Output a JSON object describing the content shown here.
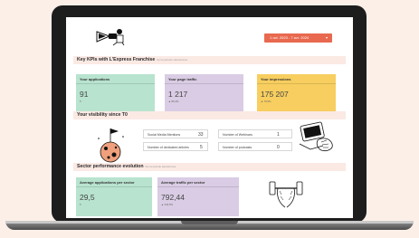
{
  "header": {
    "date_range": "1 oct. 2023 - 7 avr. 2024",
    "caret": "▾"
  },
  "kpi_section": {
    "title": "Key KPIs with L'Express Franchise",
    "note": "Sur la période sélectionnée",
    "cards": [
      {
        "label": "Your applications",
        "value": "91",
        "sub": "5",
        "color": "#b8e3cf"
      },
      {
        "label": "Your page traffic",
        "value": "1 217",
        "sub": "▲ 86,4%",
        "color": "#d9cce4"
      },
      {
        "label": "Your impressions",
        "value": "175 207",
        "sub": "▲ 79,9%",
        "color": "#f7ce5f"
      }
    ]
  },
  "visibility_section": {
    "title": "Your visibility since T0",
    "stats": [
      {
        "label": "Social Media Mentions",
        "value": "33"
      },
      {
        "label": "Number of Webinars",
        "value": "1"
      },
      {
        "label": "Number of dedicated articles",
        "value": "5"
      },
      {
        "label": "Number of podcasts",
        "value": "0"
      }
    ]
  },
  "sector_section": {
    "title": "Sector performance evolution",
    "note": "Sur la période sélectionnée",
    "cards": [
      {
        "label": "Average applications per sector",
        "value": "29,5",
        "sub": "5",
        "color": "#b8e3cf"
      },
      {
        "label": "Average traffic per sector",
        "value": "792,44",
        "sub": "▲ 234,5%",
        "color": "#d9cce4"
      }
    ]
  }
}
